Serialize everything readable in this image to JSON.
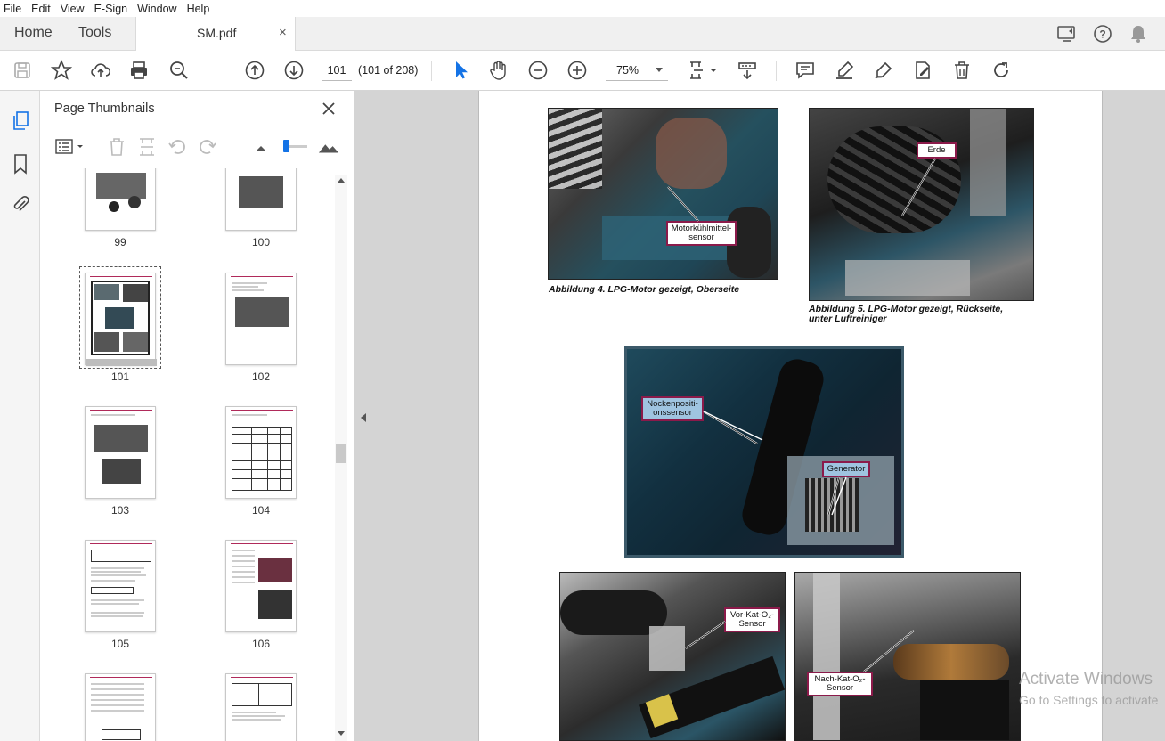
{
  "menu": [
    "File",
    "Edit",
    "View",
    "E-Sign",
    "Window",
    "Help"
  ],
  "tabs": {
    "home": "Home",
    "tools": "Tools",
    "doc": "SM.pdf",
    "close": "×"
  },
  "toolbar": {
    "page_current": "101",
    "page_count": "(101 of 208)",
    "zoom": "75%"
  },
  "panel": {
    "title": "Page Thumbnails",
    "thumbs": [
      {
        "num": "99"
      },
      {
        "num": "100"
      },
      {
        "num": "101"
      },
      {
        "num": "102"
      },
      {
        "num": "103"
      },
      {
        "num": "104"
      },
      {
        "num": "105"
      },
      {
        "num": "106"
      }
    ]
  },
  "document": {
    "fig4_callout": "Motorkühlmittel-\nsensor",
    "fig4_caption": "Abbildung 4.      LPG-Motor gezeigt, Oberseite",
    "fig5_callout": "Erde",
    "fig5_caption": "Abbildung 5.      LPG-Motor gezeigt, Rückseite,\nunter Luftreiniger",
    "fig6_callout1": "Nockenpositi-\nonssensor",
    "fig6_callout2": "Generator",
    "fig7_callout": "Vor-Kat-O₂-\nSensor",
    "fig8_callout": "Nach-Kat-O₂-\nSensor"
  },
  "watermark": {
    "line1": "Activate Windows",
    "line2": "Go to Settings to activate"
  },
  "colors": {
    "accent": "#1473e6",
    "callout_border": "#8b1a4a",
    "doc_bg": "#d4d4d4"
  }
}
